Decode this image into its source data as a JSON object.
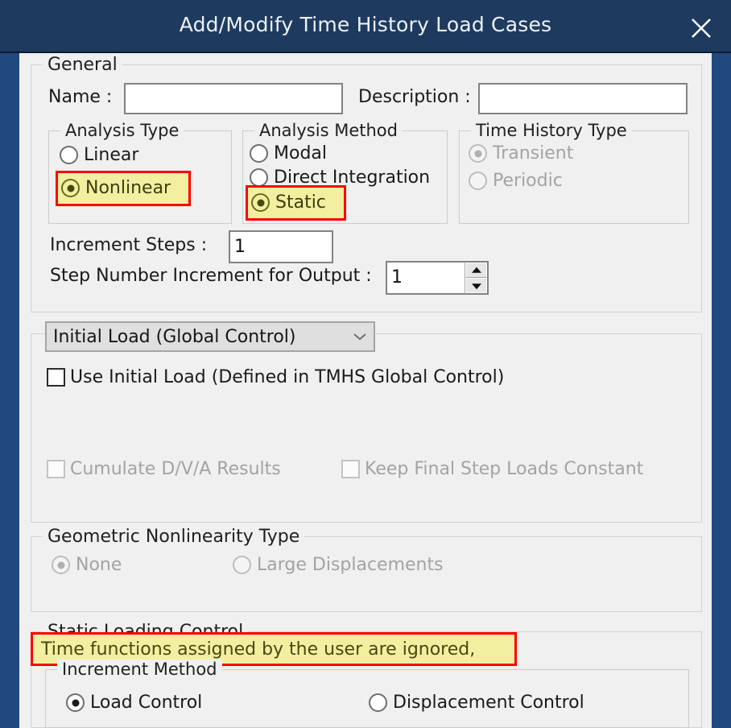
{
  "window": {
    "title": "Add/Modify Time History Load Cases",
    "close_icon": "close-icon",
    "title_bar_color": "#1e3a5f",
    "border_color": "#21487f",
    "client_color": "#f0f0f0",
    "highlight_fill": "#f2f0a0",
    "highlight_border": "#ff0000"
  },
  "general": {
    "legend": "General",
    "name_label": "Name :",
    "name_value": "",
    "description_label": "Description :",
    "description_value": "",
    "analysis_type": {
      "legend": "Analysis Type",
      "options": [
        {
          "label": "Linear",
          "checked": false,
          "highlighted": false
        },
        {
          "label": "Nonlinear",
          "checked": true,
          "highlighted": true
        }
      ]
    },
    "analysis_method": {
      "legend": "Analysis Method",
      "options": [
        {
          "label": "Modal",
          "checked": false,
          "highlighted": false
        },
        {
          "label": "Direct Integration",
          "checked": false,
          "highlighted": false
        },
        {
          "label": "Static",
          "checked": true,
          "highlighted": true
        }
      ]
    },
    "time_history_type": {
      "legend": "Time History Type",
      "disabled": true,
      "options": [
        {
          "label": "Transient",
          "checked": true
        },
        {
          "label": "Periodic",
          "checked": false
        }
      ]
    },
    "increment_steps_label": "Increment Steps :",
    "increment_steps_value": "1",
    "step_number_label": "Step Number Increment for Output :",
    "step_number_value": "1"
  },
  "initial_load": {
    "combo_value": "Initial Load (Global Control)",
    "combo_icon": "chevron-down-icon",
    "use_initial_load_label": "Use Initial Load (Defined in TMHS Global Control)",
    "use_initial_load_checked": false,
    "cumulate_label": "Cumulate D/V/A Results",
    "cumulate_checked": false,
    "cumulate_disabled": true,
    "keep_final_label": "Keep Final Step Loads Constant",
    "keep_final_checked": false,
    "keep_final_disabled": true
  },
  "geometric_nonlinearity": {
    "legend": "Geometric Nonlinearity Type",
    "disabled": true,
    "options": [
      {
        "label": "None",
        "checked": true
      },
      {
        "label": "Large Displacements",
        "checked": false
      }
    ]
  },
  "static_loading_control": {
    "legend": "Static Loading Control",
    "note": "Time functions assigned by the user are ignored,",
    "increment_method": {
      "legend": "Increment Method",
      "options": [
        {
          "label": "Load Control",
          "checked": true
        },
        {
          "label": "Displacement Control",
          "checked": false
        }
      ]
    }
  }
}
